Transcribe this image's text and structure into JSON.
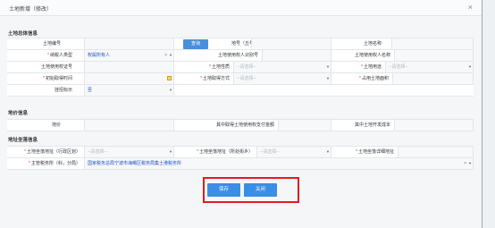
{
  "dialog": {
    "title": "土地新增（修改）",
    "close_glyph": "×"
  },
  "sections": {
    "land_basic": "土地总体信息",
    "land_price": "地价信息",
    "land_location": "地址坐落信息"
  },
  "basic": {
    "land_no_label": "土地编号",
    "query_button": "查询",
    "parcel_no_label": "地号（丘号）",
    "land_name_label": "土地名称",
    "taxpayer_type_label": "纳税人类型",
    "taxpayer_type_value": "权属所有人",
    "user_id_label": "土地使用权人识别号",
    "user_name_label": "土地使用权人名称",
    "cert_label": "土地使用权证号",
    "nature_label": "土地性质",
    "nature_placeholder": "--请选择--",
    "usage_label": "土地用途",
    "usage_placeholder": "--请选择--",
    "acquire_time_label": "初始取得时间",
    "acquire_method_label": "土地取得方式",
    "acquire_method_placeholder": "--请选择--",
    "area_label": "占用土地面积",
    "bid_label": "挂招标示",
    "bid_value": "否"
  },
  "price": {
    "land_price_label": "地价",
    "paid_label": "其中取得土地使用权支付金额",
    "dev_cost_label": "其中土地开发成本"
  },
  "location": {
    "addr_label": "土地坐落地址（行政区划）",
    "addr_placeholder": "--请选择--",
    "street_label": "土地坐落地址（所处街乡）",
    "street_placeholder": "--请选择--",
    "detail_label": "土地坐落详细地址",
    "tax_office_label": "主管税务所（科，分局）",
    "tax_office_value": "国家税务总局宁波市海曙区税务局集士港税务所"
  },
  "footer": {
    "save_label": "保存",
    "close_label": "关闭"
  },
  "colors": {
    "accent": "#3a8ee6",
    "highlight_box": "#e21b1b",
    "required": "#e04040"
  }
}
